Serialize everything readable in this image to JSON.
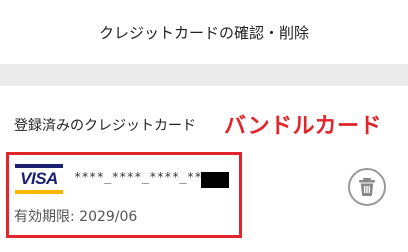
{
  "header": {
    "title": "クレジットカードの確認・削除"
  },
  "section": {
    "title": "登録済みのクレジットカード"
  },
  "annotation": {
    "text": "バンドルカード"
  },
  "card": {
    "brand": "VISA",
    "number_masked": "****_****_****_**",
    "expiry_label": "有効期限:",
    "expiry_value": "2029/06"
  },
  "icons": {
    "delete": "trash-icon"
  },
  "colors": {
    "annotation": "#e0252b",
    "visa_blue": "#1a1f71",
    "visa_gold": "#f7b600"
  }
}
